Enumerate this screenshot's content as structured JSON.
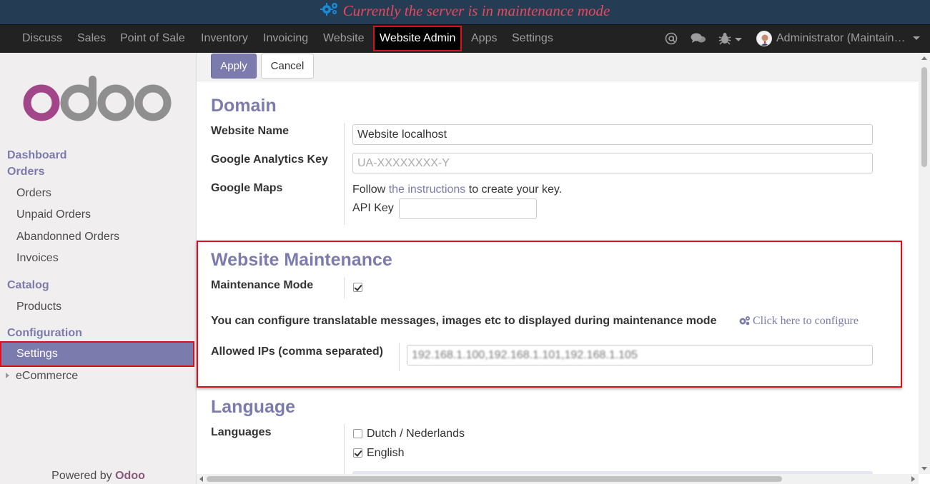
{
  "banner": {
    "text": "Currently the server is in maintenance mode"
  },
  "nav": {
    "items": [
      "Discuss",
      "Sales",
      "Point of Sale",
      "Inventory",
      "Invoicing",
      "Website",
      "Website Admin",
      "Apps",
      "Settings"
    ],
    "active": "Website Admin",
    "user": "Administrator (Maintain…"
  },
  "sidebar": {
    "sections": {
      "dashboard": "Dashboard",
      "orders": "Orders",
      "catalog": "Catalog",
      "configuration": "Configuration"
    },
    "order_items": [
      "Orders",
      "Unpaid Orders",
      "Abandonned Orders",
      "Invoices"
    ],
    "catalog_items": [
      "Products"
    ],
    "config_items": [
      "Settings",
      "eCommerce"
    ],
    "powered_prefix": "Powered by",
    "powered_brand": "Odoo"
  },
  "toolbar": {
    "apply": "Apply",
    "cancel": "Cancel"
  },
  "domain": {
    "title": "Domain",
    "website_name_label": "Website Name",
    "website_name_value": "Website localhost",
    "ga_label": "Google Analytics Key",
    "ga_placeholder": "UA-XXXXXXXX-Y",
    "maps_label": "Google Maps",
    "maps_follow": "Follow",
    "maps_link": "the instructions",
    "maps_rest": "to create your key.",
    "api_key_label": "API Key"
  },
  "maintenance": {
    "title": "Website Maintenance",
    "mode_label": "Maintenance Mode",
    "mode_checked": true,
    "configure_text": "You can configure translatable messages, images etc to displayed during maintenance mode",
    "configure_link": "Click here to configure",
    "ips_label": "Allowed IPs (comma separated)",
    "ips_value": "192.168.1.100,192.168.1.101,192.168.1.105"
  },
  "language": {
    "title": "Language",
    "languages_label": "Languages",
    "options": [
      {
        "label": "Dutch / Nederlands",
        "checked": false
      },
      {
        "label": "English",
        "checked": true
      }
    ]
  },
  "colors": {
    "accent": "#7c7bad",
    "banner_bg": "#253c55",
    "banner_text": "#e8485a",
    "highlight": "#d9111d",
    "nav_bg": "#222222"
  }
}
